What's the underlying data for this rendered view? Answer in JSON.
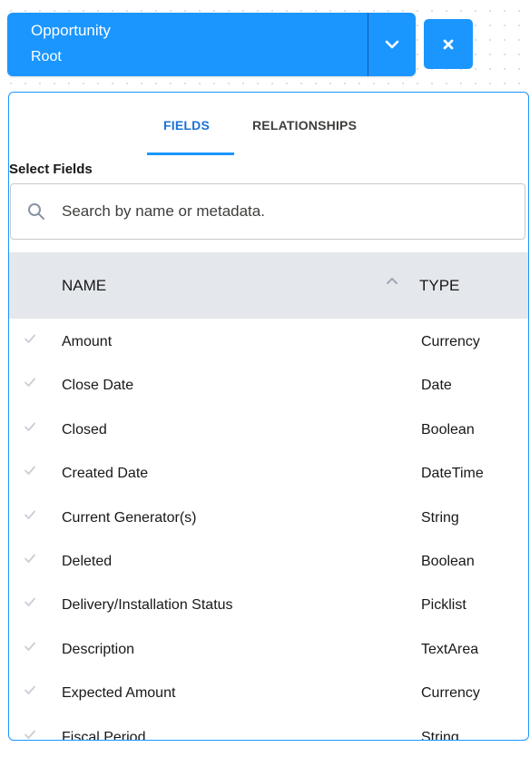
{
  "object_selector": {
    "name": "Opportunity",
    "sub": "Root"
  },
  "tabs": {
    "fields": "FIELDS",
    "relationships": "RELATIONSHIPS"
  },
  "select_fields_label": "Select Fields",
  "search": {
    "placeholder": "Search by name or metadata."
  },
  "table": {
    "headers": {
      "name": "NAME",
      "type": "TYPE"
    },
    "rows": [
      {
        "name": "Amount",
        "type": "Currency"
      },
      {
        "name": "Close Date",
        "type": "Date"
      },
      {
        "name": "Closed",
        "type": "Boolean"
      },
      {
        "name": "Created Date",
        "type": "DateTime"
      },
      {
        "name": "Current Generator(s)",
        "type": "String"
      },
      {
        "name": "Deleted",
        "type": "Boolean"
      },
      {
        "name": "Delivery/Installation Status",
        "type": "Picklist"
      },
      {
        "name": "Description",
        "type": "TextArea"
      },
      {
        "name": "Expected Amount",
        "type": "Currency"
      },
      {
        "name": "Fiscal Period",
        "type": "String"
      }
    ]
  },
  "colors": {
    "accent": "#1b96ff",
    "header_bg": "#e4e7ec",
    "tab_active": "#1b73d4"
  },
  "icons": {
    "toggle": "chevron-down-icon",
    "close": "close-icon",
    "search": "search-icon",
    "sort": "sort-ascending-icon",
    "row_check": "check-icon"
  }
}
